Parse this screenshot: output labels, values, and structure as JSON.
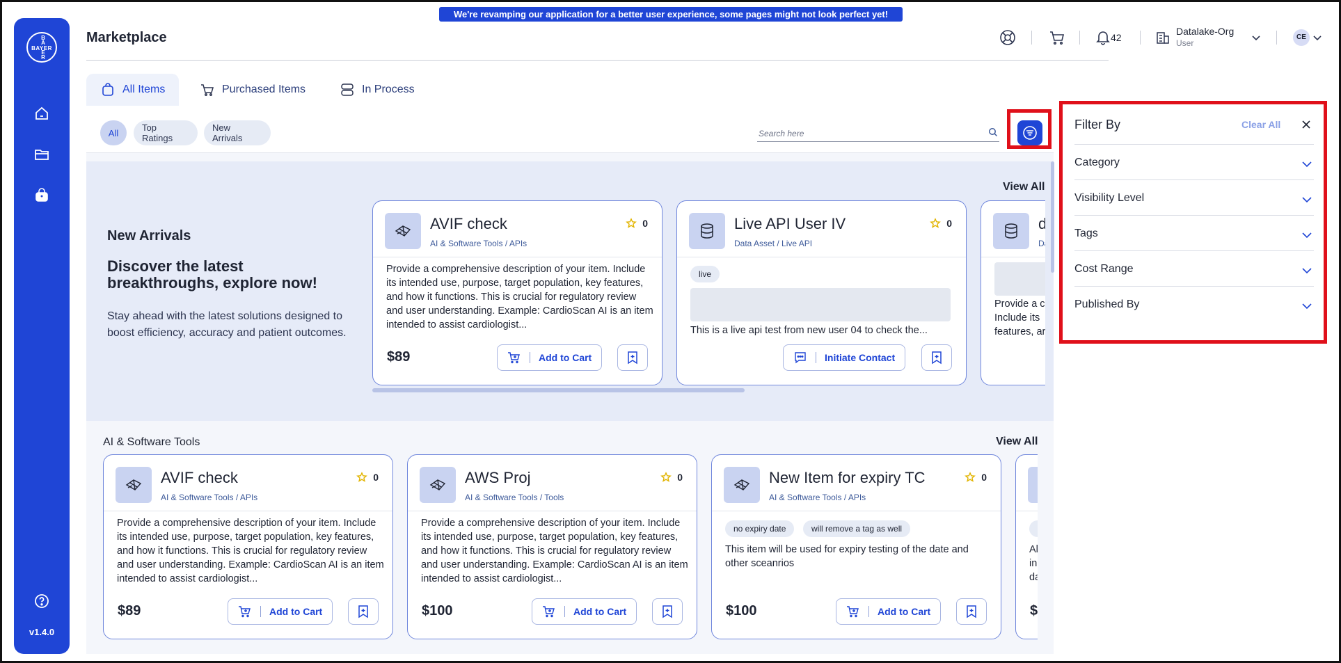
{
  "banner": "We're revamping our application for a better user experience, some pages might not look perfect yet!",
  "sidebar": {
    "logo_h": "BAYER",
    "logo_v": "BAER",
    "version": "v1.4.0"
  },
  "header": {
    "title": "Marketplace",
    "notifications": "42",
    "org_name": "Datalake-Org",
    "org_role": "User",
    "avatar": "CE"
  },
  "tabs": [
    {
      "label": "All Items"
    },
    {
      "label": "Purchased Items"
    },
    {
      "label": "In Process"
    }
  ],
  "chips": [
    "All",
    "Top Ratings",
    "New Arrivals"
  ],
  "search": {
    "placeholder": "Search here"
  },
  "new_arrivals": {
    "title": "New Arrivals",
    "headline": "Discover the latest breakthroughs, explore now!",
    "text": "Stay ahead with the latest solutions designed to boost efficiency, accuracy and patient outcomes.",
    "view_all": "View All",
    "cards": [
      {
        "title": "AVIF check",
        "subtitle": "AI & Software Tools / APIs",
        "rating": "0",
        "description": "Provide a comprehensive description of your item. Include its intended use, purpose, target population, key features, and how it functions. This is crucial for regulatory review and user understanding. Example: CardioScan AI is an item intended to assist cardiologist...",
        "price": "$89",
        "action": "Add to Cart"
      },
      {
        "title": "Live API User IV",
        "subtitle": "Data Asset / Live API",
        "rating": "0",
        "tag": "live",
        "description": "This is a live api test from new user 04 to check the...",
        "action": "Initiate Contact"
      },
      {
        "title": "d",
        "subtitle": "Da",
        "description": "Provide a c Include its features, ar"
      }
    ]
  },
  "ai_section": {
    "title": "AI & Software Tools",
    "view_all": "View All",
    "cards": [
      {
        "title": "AVIF check",
        "subtitle": "AI & Software Tools / APIs",
        "rating": "0",
        "description": "Provide a comprehensive description of your item. Include its intended use, purpose, target population, key features, and how it functions. This is crucial for regulatory review and user understanding. Example: CardioScan AI is an item intended to assist cardiologist...",
        "price": "$89",
        "action": "Add to Cart"
      },
      {
        "title": "AWS Proj",
        "subtitle": "AI & Software Tools / Tools",
        "rating": "0",
        "description": "Provide a comprehensive description of your item. Include its intended use, purpose, target population, key features, and how it functions. This is crucial for regulatory review and user understanding. Example: CardioScan AI is an item intended to assist cardiologist...",
        "price": "$100",
        "action": "Add to Cart"
      },
      {
        "title": "New Item for expiry TC",
        "subtitle": "AI & Software Tools / APIs",
        "rating": "0",
        "tags": [
          "no expiry date",
          "will remove a tag as well"
        ],
        "description": "This item will be used for expiry testing of the date and other sceanrios",
        "price": "$100",
        "action": "Add to Cart"
      },
      {
        "description": "Al in da",
        "price": "$"
      }
    ]
  },
  "filter_panel": {
    "title": "Filter By",
    "clear_all": "Clear All",
    "sections": [
      "Category",
      "Visibility Level",
      "Tags",
      "Cost Range",
      "Published By"
    ]
  },
  "colors": {
    "brand": "#1f45d6",
    "highlight": "#e0101a",
    "section_bg": "#e6ebf8"
  }
}
